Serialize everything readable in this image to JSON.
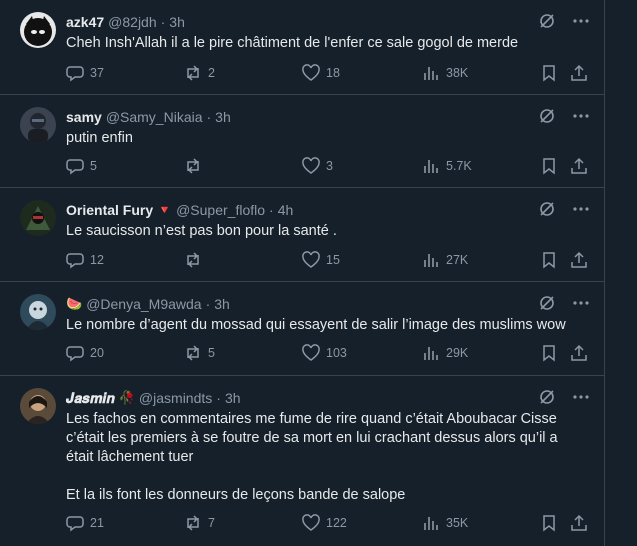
{
  "tweets": [
    {
      "name": "azk47",
      "handle": "@82jdh",
      "time": "3h",
      "text": "Cheh Insh'Allah il a le pire châtiment de l'enfer ce sale gogol de merde",
      "replies": "37",
      "retweets": "2",
      "likes": "18",
      "views": "38K",
      "avatar_color": "#1a1a1a"
    },
    {
      "name": "samy",
      "handle": "@Samy_Nikaia",
      "time": "3h",
      "text": "putin enfin",
      "replies": "5",
      "retweets": "",
      "likes": "3",
      "views": "5.7K",
      "avatar_color": "#3b4250"
    },
    {
      "name": "Oriental Fury",
      "name_badge": "🔻",
      "handle": "@Super_floflo",
      "time": "4h",
      "text": "Le saucisson n’est pas bon pour la santé .",
      "replies": "12",
      "retweets": "",
      "likes": "15",
      "views": "27K",
      "avatar_color": "#2c3a2c"
    },
    {
      "name": "🍉",
      "handle": "@Denya_M9awda",
      "time": "3h",
      "text": "Le nombre d’agent du mossad qui essayent de salir l’image des muslims wow",
      "replies": "20",
      "retweets": "5",
      "likes": "103",
      "views": "29K",
      "avatar_color": "#2f4a5a"
    },
    {
      "name": "𝑱𝒂𝒔𝒎𝒊𝒏",
      "name_badge": "🥀",
      "handle": "@jasmindts",
      "time": "3h",
      "text": "Les fachos en commentaires me fume de rire quand c’était Aboubacar Cisse c’était les premiers à se foutre de sa mort en lui crachant dessus alors qu’il a était lâchement tuer\n\nEt la ils font les donneurs de leçons bande de salope",
      "replies": "21",
      "retweets": "7",
      "likes": "122",
      "views": "35K",
      "avatar_color": "#5a4a3a"
    }
  ],
  "icons": {
    "grok": "grok-icon",
    "more": "more-icon",
    "reply": "reply-icon",
    "retweet": "retweet-icon",
    "like": "like-icon",
    "views": "views-icon",
    "bookmark": "bookmark-icon",
    "share": "share-icon"
  },
  "colors": {
    "background": "#15202b",
    "border": "#38444d",
    "text": "#e7e9ea",
    "muted": "#8b98a5"
  }
}
